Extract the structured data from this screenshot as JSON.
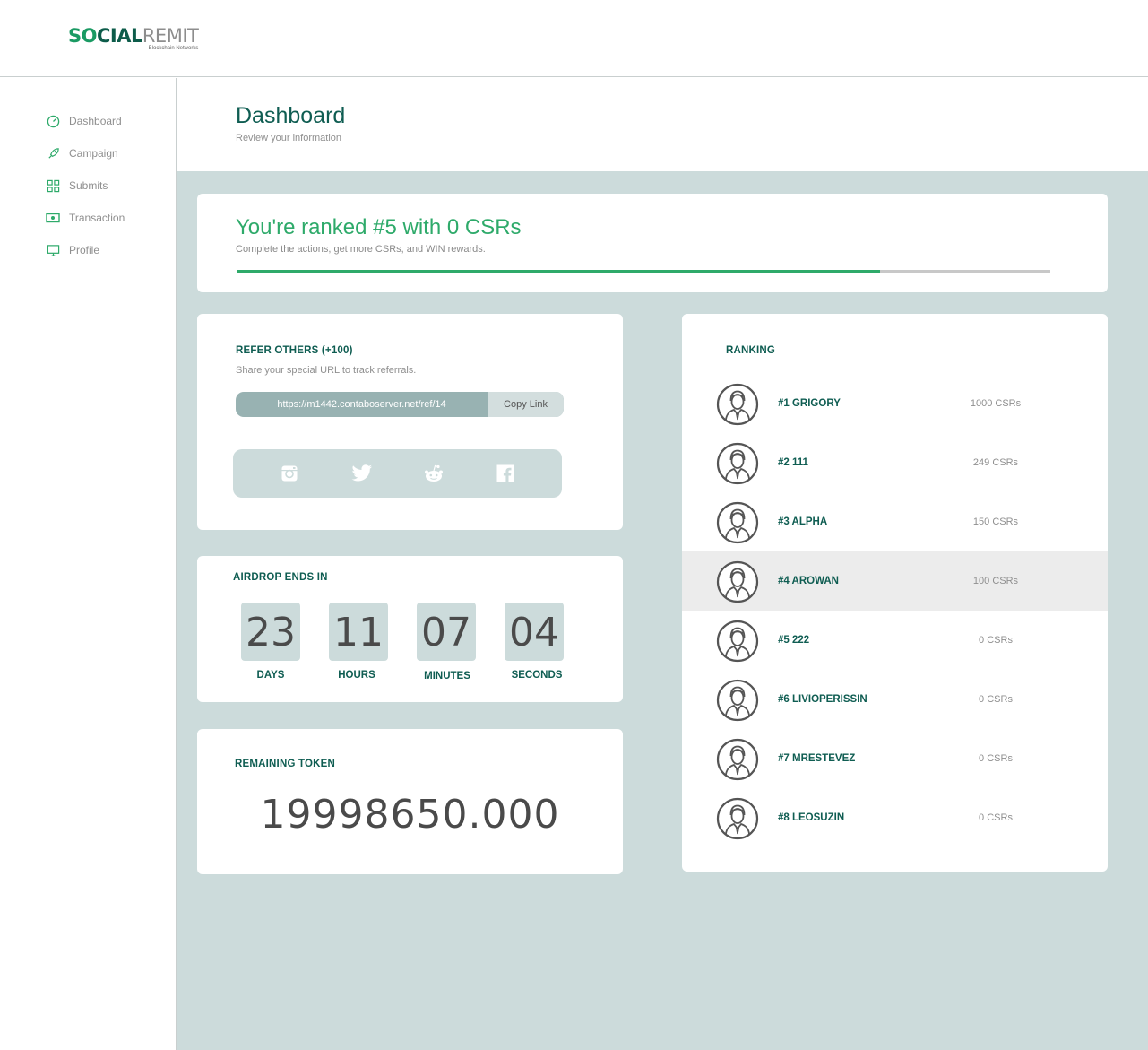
{
  "logo": {
    "part1": "SO",
    "part2": "CIAL",
    "part3": "REMIT",
    "tagline": "Blockchain Networks"
  },
  "nav": [
    {
      "label": "Dashboard",
      "icon": "speedometer-icon"
    },
    {
      "label": "Campaign",
      "icon": "rocket-icon"
    },
    {
      "label": "Submits",
      "icon": "grid-icon"
    },
    {
      "label": "Transaction",
      "icon": "money-icon"
    },
    {
      "label": "Profile",
      "icon": "monitor-icon"
    }
  ],
  "header": {
    "title": "Dashboard",
    "subtitle": "Review your information"
  },
  "rank_summary": {
    "headline": "You're ranked #5 with 0 CSRs",
    "description": "Complete the actions, get more CSRs, and WIN rewards.",
    "progress": 0.79
  },
  "refer": {
    "title": "REFER OTHERS (+100)",
    "description": "Share your special URL to track referrals.",
    "url": "https://m1442.contaboserver.net/ref/14",
    "copy_label": "Copy Link",
    "socials": [
      "instagram-icon",
      "twitter-icon",
      "reddit-icon",
      "facebook-icon"
    ]
  },
  "airdrop": {
    "title": "AIRDROP ENDS IN",
    "units": [
      {
        "value": "23",
        "label": "DAYS"
      },
      {
        "value": "11",
        "label": "HOURS"
      },
      {
        "value": "07",
        "label": "MINUTES"
      },
      {
        "value": "04",
        "label": "SECONDS"
      }
    ]
  },
  "token": {
    "title": "REMAINING TOKEN",
    "value": "19998650.000"
  },
  "ranking": {
    "title": "RANKING",
    "rows": [
      {
        "name": "#1 GRIGORY",
        "points": "1000 CSRs",
        "highlight": false
      },
      {
        "name": "#2 111",
        "points": "249 CSRs",
        "highlight": false
      },
      {
        "name": "#3 ALPHA",
        "points": "150 CSRs",
        "highlight": false
      },
      {
        "name": "#4 AROWAN",
        "points": "100 CSRs",
        "highlight": true
      },
      {
        "name": "#5 222",
        "points": "0 CSRs",
        "highlight": false
      },
      {
        "name": "#6 LIVIOPERISSIN",
        "points": "0 CSRs",
        "highlight": false
      },
      {
        "name": "#7 MRESTEVEZ",
        "points": "0 CSRs",
        "highlight": false
      },
      {
        "name": "#8 LEOSUZIN",
        "points": "0 CSRs",
        "highlight": false
      }
    ]
  },
  "colors": {
    "accent_green": "#2eaa6a",
    "dark_teal": "#0f5d52",
    "panel_bg": "#ccdbdb"
  }
}
